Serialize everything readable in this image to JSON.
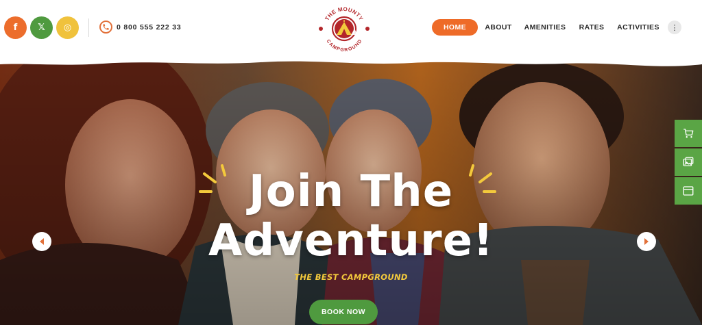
{
  "header": {
    "social": [
      {
        "icon": "facebook-icon",
        "glyph": "f"
      },
      {
        "icon": "x-icon",
        "glyph": "𝕏"
      },
      {
        "icon": "instagram-icon",
        "glyph": "◎"
      }
    ],
    "phone": "0 800 555 222 33",
    "logo": {
      "top_text": "THE MOUNTY",
      "bottom_text": "CAMPGROUND"
    },
    "nav": [
      {
        "label": "HOME",
        "active": true
      },
      {
        "label": "ABOUT"
      },
      {
        "label": "AMENITIES"
      },
      {
        "label": "RATES"
      },
      {
        "label": "ACTIVITIES"
      }
    ],
    "more_glyph": "⋮"
  },
  "hero": {
    "headline_line1": "Join The",
    "headline_line2": "Adventure!",
    "tagline": "THE BEST CAMPGROUND",
    "cta": "BOOK NOW"
  },
  "side_tools": [
    {
      "icon": "cart-icon"
    },
    {
      "icon": "gallery-icon"
    },
    {
      "icon": "window-icon"
    }
  ],
  "colors": {
    "orange": "#ee6b28",
    "green": "#4f9a3f",
    "yellow": "#f3c93c",
    "logo_red": "#b3262a"
  }
}
